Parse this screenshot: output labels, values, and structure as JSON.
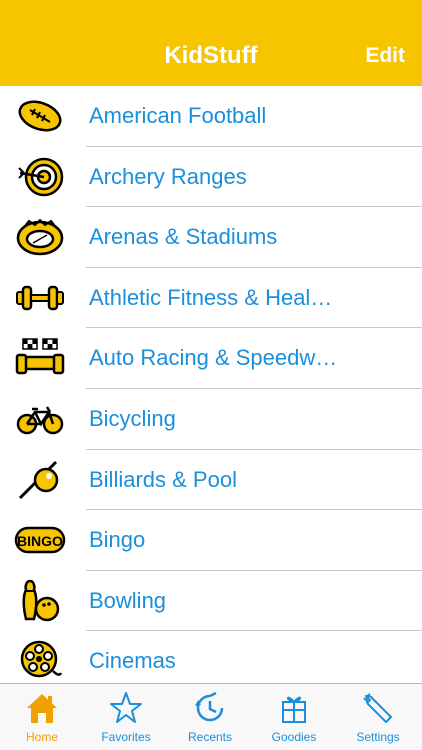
{
  "navbar": {
    "title": "KidStuff",
    "edit_label": "Edit"
  },
  "categories": [
    {
      "label": "American Football",
      "icon": "football-icon"
    },
    {
      "label": "Archery Ranges",
      "icon": "archery-target-icon"
    },
    {
      "label": "Arenas & Stadiums",
      "icon": "stadium-icon"
    },
    {
      "label": "Athletic  Fitness & Heal…",
      "icon": "dumbbell-icon"
    },
    {
      "label": "Auto Racing & Speedw…",
      "icon": "race-car-icon"
    },
    {
      "label": "Bicycling",
      "icon": "bicycle-icon"
    },
    {
      "label": "Billiards & Pool",
      "icon": "billiard-cue-icon"
    },
    {
      "label": "Bingo",
      "icon": "bingo-icon"
    },
    {
      "label": "Bowling",
      "icon": "bowling-icon"
    },
    {
      "label": "Cinemas",
      "icon": "film-reel-icon"
    }
  ],
  "tabs": [
    {
      "label": "Home",
      "icon": "home-icon",
      "active": true
    },
    {
      "label": "Favorites",
      "icon": "star-icon"
    },
    {
      "label": "Recents",
      "icon": "clock-icon"
    },
    {
      "label": "Goodies",
      "icon": "gift-icon"
    },
    {
      "label": "Settings",
      "icon": "wrench-icon"
    }
  ],
  "colors": {
    "navbar": "#f6c500",
    "label": "#1a8fdc",
    "icon_fill": "#f6c500",
    "tab_active": "#f0a000"
  }
}
